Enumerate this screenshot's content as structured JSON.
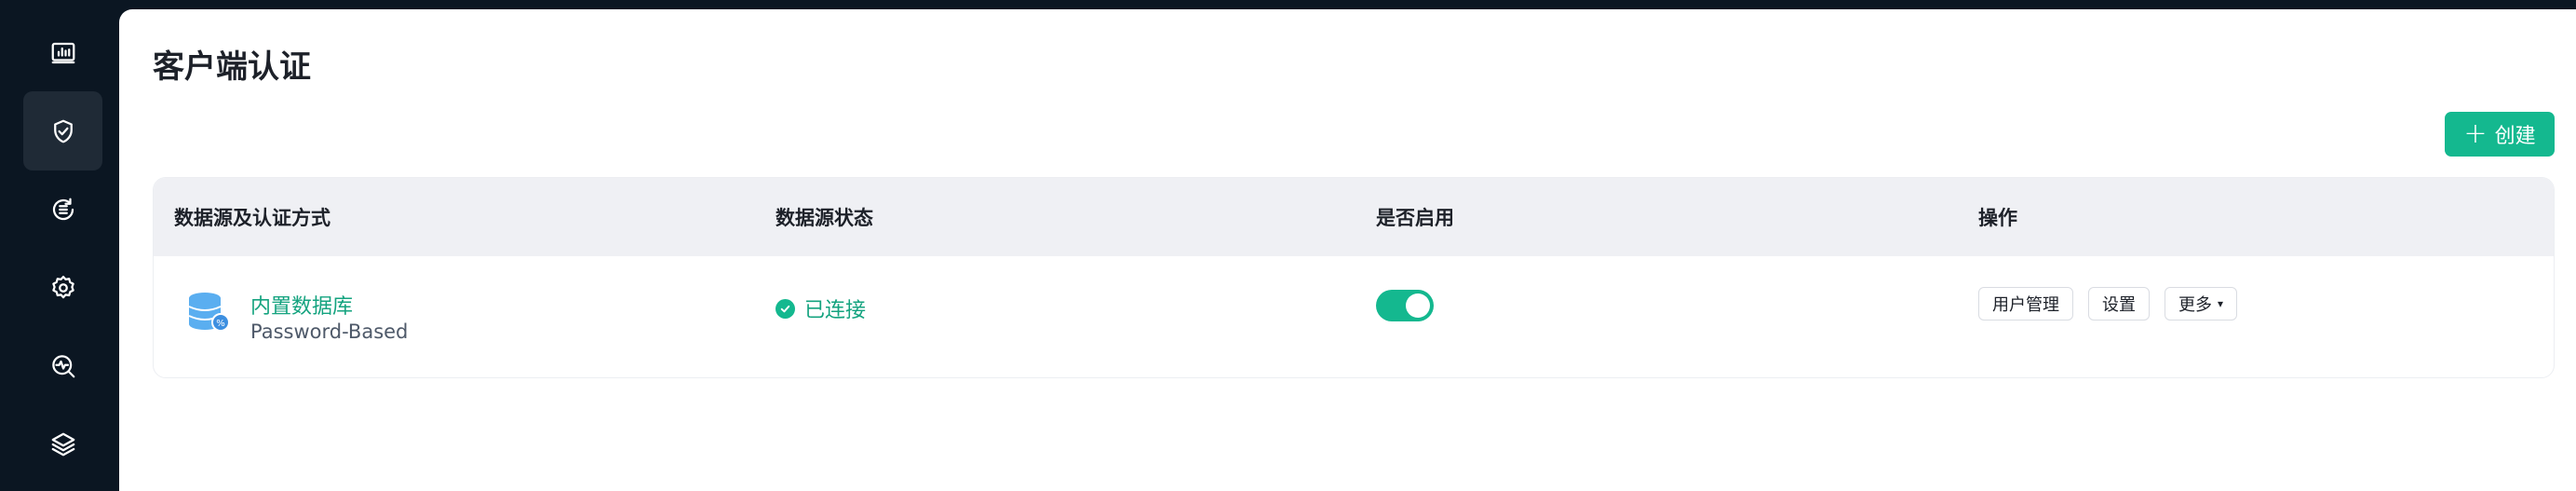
{
  "sidebar": {
    "items": [
      {
        "icon": "dashboard-icon",
        "active": false
      },
      {
        "icon": "shield-check-icon",
        "active": true
      },
      {
        "icon": "list-cycle-icon",
        "active": false
      },
      {
        "icon": "gear-icon",
        "active": false
      },
      {
        "icon": "diagnose-icon",
        "active": false
      },
      {
        "icon": "layers-icon",
        "active": false
      }
    ]
  },
  "page": {
    "title": "客户端认证",
    "create_label": "创建"
  },
  "table": {
    "columns": [
      "数据源及认证方式",
      "数据源状态",
      "是否启用",
      "操作"
    ],
    "rows": [
      {
        "source_name": "内置数据库",
        "auth_type": "Password-Based",
        "status": "已连接",
        "enabled": true,
        "actions": [
          "用户管理",
          "设置",
          "更多"
        ]
      }
    ]
  },
  "colors": {
    "accent": "#14b88f",
    "sidebar_bg": "#0b1622",
    "header_bg": "#eff0f4"
  }
}
